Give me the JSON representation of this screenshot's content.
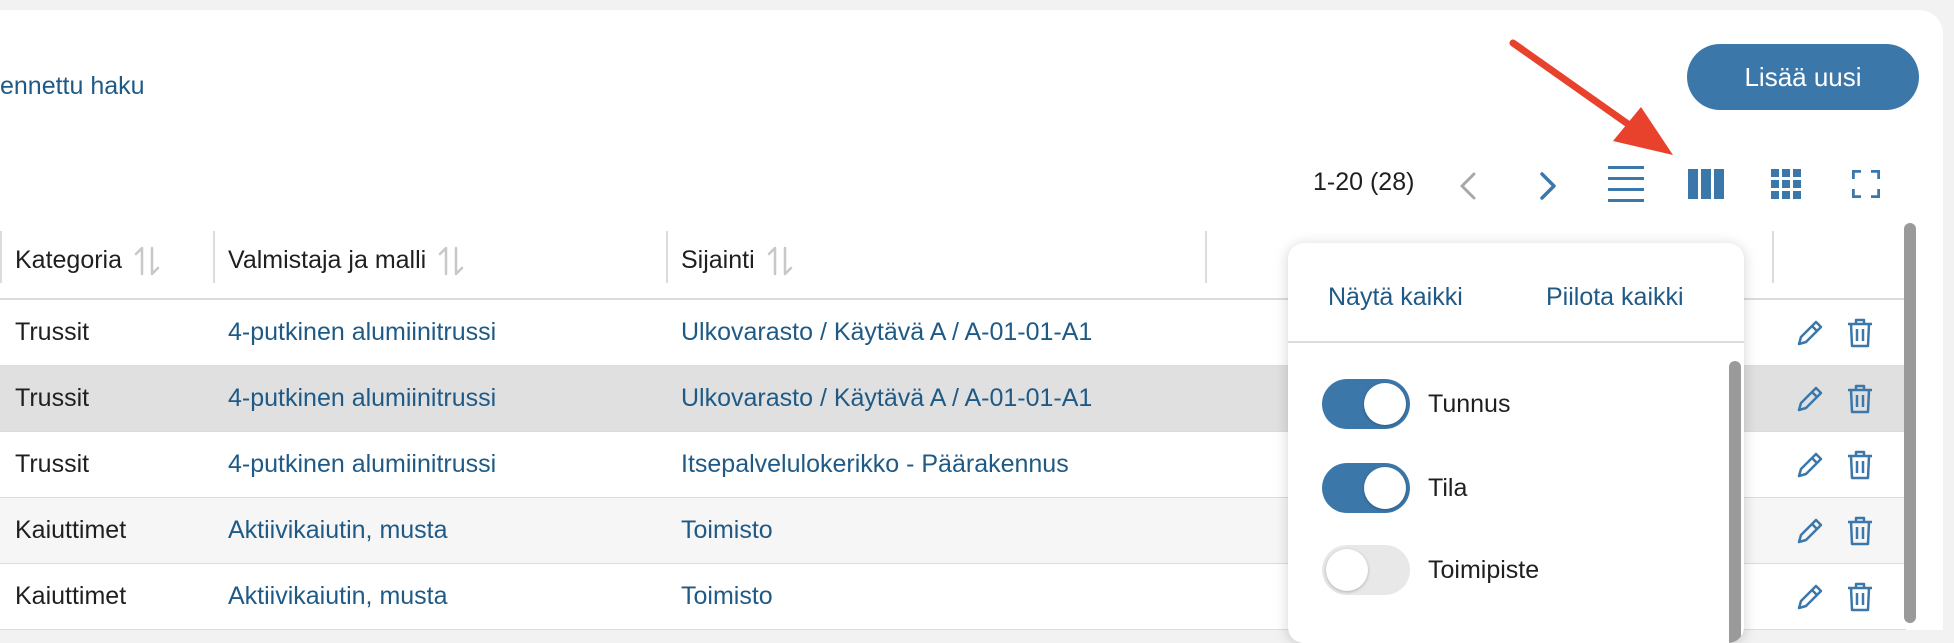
{
  "header": {
    "advanced_search_label": "ennettu haku",
    "add_new_label": "Lisää uusi"
  },
  "pagination": {
    "range_label": "1-20 (28)"
  },
  "table": {
    "columns": [
      {
        "label": "Kategoria"
      },
      {
        "label": "Valmistaja ja malli"
      },
      {
        "label": "Sijainti"
      }
    ],
    "rows": [
      {
        "category": "Trussit",
        "model": "4-putkinen alumiinitrussi",
        "location": "Ulkovarasto / Käytävä A / A-01-01-A1"
      },
      {
        "category": "Trussit",
        "model": "4-putkinen alumiinitrussi",
        "location": "Ulkovarasto / Käytävä A / A-01-01-A1"
      },
      {
        "category": "Trussit",
        "model": "4-putkinen alumiinitrussi",
        "location": "Itsepalvelulokerikko - Päärakennus"
      },
      {
        "category": "Kaiuttimet",
        "model": "Aktiivikaiutin, musta",
        "location": "Toimisto"
      },
      {
        "category": "Kaiuttimet",
        "model": "Aktiivikaiutin, musta",
        "location": "Toimisto"
      }
    ]
  },
  "column_menu": {
    "show_all_label": "Näytä kaikki",
    "hide_all_label": "Piilota kaikki",
    "toggles": [
      {
        "label": "Tunnus",
        "state": "on"
      },
      {
        "label": "Tila",
        "state": "on"
      },
      {
        "label": "Toimipiste",
        "state": "off"
      }
    ]
  },
  "icons": {
    "prev": "chevron-left-icon",
    "next": "chevron-right-icon",
    "list_view": "list-view-icon",
    "column_view": "columns-icon",
    "grid_view": "grid-icon",
    "fullscreen": "fullscreen-icon",
    "sort": "sort-icon",
    "edit": "pencil-icon",
    "delete": "trash-icon",
    "annotation": "red-arrow-icon"
  },
  "colors": {
    "accent": "#3c77aa",
    "link": "#1f5a86",
    "annotation_arrow": "#e8412c",
    "row_hover": "#e0e0e0"
  }
}
